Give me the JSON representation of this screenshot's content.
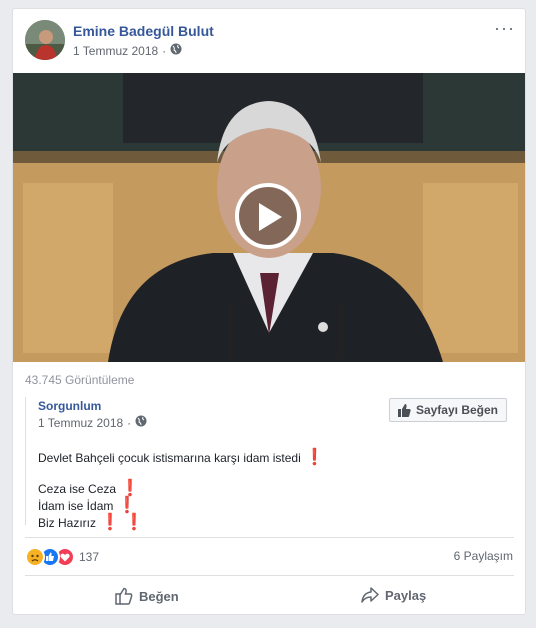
{
  "post": {
    "author": "Emine Badegül Bulut",
    "date": "1 Temmuz 2018",
    "more_icon": "···",
    "views": "43.745 Görüntüleme"
  },
  "shared": {
    "author": "Sorgunlum",
    "date": "1 Temmuz 2018",
    "like_page": "Sayfayı Beğen",
    "line1": "Devlet Bahçeli çocuk istismarına karşı idam istedi",
    "line2": "Ceza ise Ceza",
    "line3": "İdam ise İdam",
    "line4": "Biz Hazırız",
    "bang": "❗"
  },
  "stats": {
    "reaction_count": "137",
    "shares": "6 Paylaşım"
  },
  "actions": {
    "like": "Beğen",
    "share": "Paylaş"
  },
  "colors": {
    "link": "#365899",
    "like_blue": "#1877f2",
    "love_red": "#f33e58",
    "sad_yellow": "#f7b125"
  }
}
